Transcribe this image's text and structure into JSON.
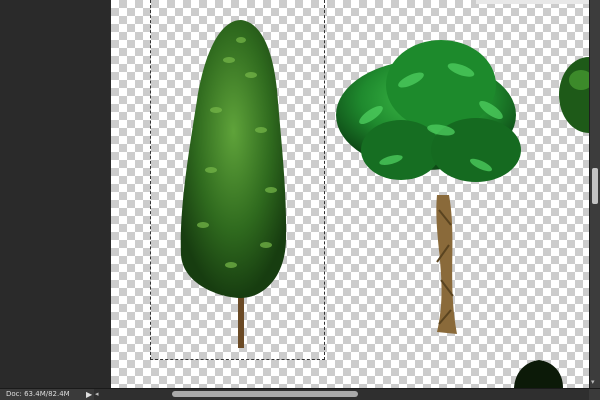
{
  "status_bar": {
    "doc_info": "Doc: 63.4M/82.4M",
    "menu_arrow": "▶",
    "scroll_left_arrow": "◂",
    "scroll_down_arrow": "▾"
  }
}
